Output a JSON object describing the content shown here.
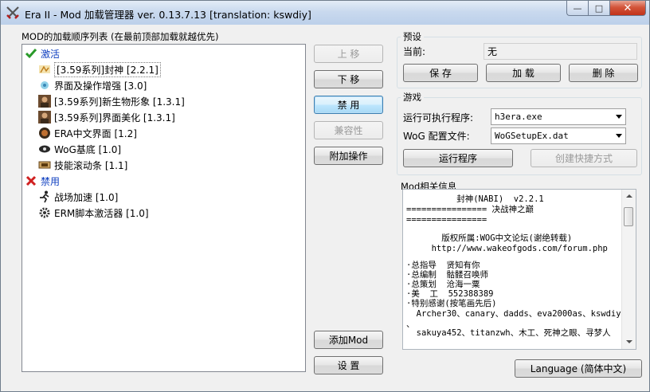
{
  "window": {
    "title": "Era II - Mod 加载管理器 ver. 0.13.7.13 [translation: kswdiy]",
    "minimize": "—",
    "maximize": "□",
    "close": "✕"
  },
  "mod_list": {
    "label": "MOD的加载顺序列表 (在最前顶部加载就越优先)",
    "active_group": "激活",
    "active_items": [
      {
        "label": "[3.59系列]封神 [2.2.1]",
        "icon": "feng-shen-icon"
      },
      {
        "label": "界面及操作增强 [3.0]",
        "icon": "interface-icon"
      },
      {
        "label": "[3.59系列]新生物形象 [1.3.1]",
        "icon": "portrait-icon"
      },
      {
        "label": "[3.59系列]界面美化 [1.3.1]",
        "icon": "portrait-icon"
      },
      {
        "label": "ERA中文界面 [1.2]",
        "icon": "era-icon"
      },
      {
        "label": "WoG基底 [1.0]",
        "icon": "wog-icon"
      },
      {
        "label": "技能滚动条 [1.1]",
        "icon": "scrollbar-icon"
      }
    ],
    "disabled_group": "禁用",
    "disabled_items": [
      {
        "label": "战场加速 [1.0]",
        "icon": "runner-icon"
      },
      {
        "label": "ERM脚本激活器 [1.0]",
        "icon": "gear-icon"
      }
    ]
  },
  "actions": {
    "move_up": "上 移",
    "move_down": "下 移",
    "disable": "禁 用",
    "compatibility": "兼容性",
    "extra_ops": "附加操作",
    "add_mod": "添加Mod",
    "settings": "设 置"
  },
  "preset": {
    "label": "预设",
    "current_label": "当前:",
    "current_value": "无",
    "save": "保 存",
    "load": "加 载",
    "delete": "删 除"
  },
  "game": {
    "label": "游戏",
    "exe_label": "运行可执行程序:",
    "exe_value": "h3era.exe",
    "config_label": "WoG 配置文件:",
    "config_value": "WoGSetupEx.dat",
    "run": "运行程序",
    "shortcut": "创建快捷方式"
  },
  "info": {
    "label": "Mod相关信息",
    "lines": [
      "          封神(NABI)  v2.2.1",
      "================ 决战神之巅",
      "================",
      "",
      "       版权所属:WOG中文论坛(谢绝转载)",
      "     http://www.wakeofgods.com/forum.php",
      "",
      "·总指导  贤知有你",
      "·总编制  骷髅召唤师",
      "·总策划  沧海一粟",
      "·美  工  552388389",
      "·特别感谢(按笔画先后)",
      "  Archer30、canary、dadds、eva2000as、kswdiy",
      "、",
      "  sakuya452、titanzwh、木工、死神之眼、寻梦人"
    ]
  },
  "language_button": "Language (简体中文)"
}
